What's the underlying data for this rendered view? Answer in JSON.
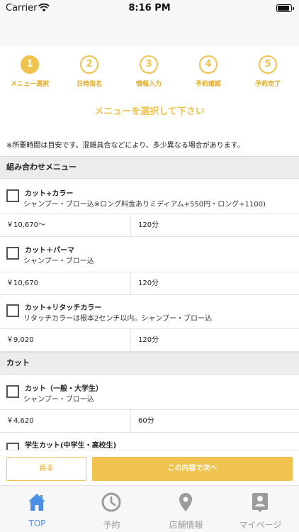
{
  "status_bar": {
    "carrier": "Carrier",
    "time": "8:16 PM"
  },
  "stepper": [
    {
      "number": "1",
      "label": "メニュー選択",
      "active": true
    },
    {
      "number": "2",
      "label": "日時指名",
      "active": false
    },
    {
      "number": "3",
      "label": "情報入力",
      "active": false
    },
    {
      "number": "4",
      "label": "予約確認",
      "active": false
    },
    {
      "number": "5",
      "label": "予約完了",
      "active": false
    }
  ],
  "instruction": "メニューを選択して下さい",
  "note": "※所要時間は目安です。混雑具合などにより、多少異なる場合があります。",
  "sections": [
    {
      "title": "組み合わせメニュー",
      "items": [
        {
          "name": "カット+カラー",
          "description": "シャンプー・ブロー込※ロング料金ありミディアム+550円・ロング+1100)",
          "price": "￥10,670〜",
          "duration": "120分"
        },
        {
          "name": "カット＋パーマ",
          "description": "シャンプー・ブロー込",
          "price": "￥10,670",
          "duration": "120分"
        },
        {
          "name": "カット+リタッチカラー",
          "description": "リタッチカラーは根本2センチ以内。シャンプー・ブロー込",
          "price": "￥9,020",
          "duration": "120分"
        }
      ]
    },
    {
      "title": "カット",
      "items": [
        {
          "name": "カット（一般・大学生）",
          "description": "シャンプー・ブロー込",
          "price": "￥4,620",
          "duration": "60分"
        },
        {
          "name": "学生カット(中学生・高校生)",
          "description": "",
          "price": "",
          "duration": ""
        }
      ]
    }
  ],
  "actions": {
    "back_label": "戻る",
    "next_label": "この内容で次へ"
  },
  "tabbar": [
    {
      "label": "TOP",
      "icon": "home-icon",
      "active": true
    },
    {
      "label": "予約",
      "icon": "clock-icon",
      "active": false
    },
    {
      "label": "店舗情報",
      "icon": "map-pin-icon",
      "active": false
    },
    {
      "label": "マイページ",
      "icon": "person-badge-icon",
      "active": false
    }
  ],
  "colors": {
    "accent": "#f0c24f",
    "tab_active": "#4a8fe4",
    "tab_inactive": "#9b9b9b",
    "section_bg": "#ececec"
  }
}
